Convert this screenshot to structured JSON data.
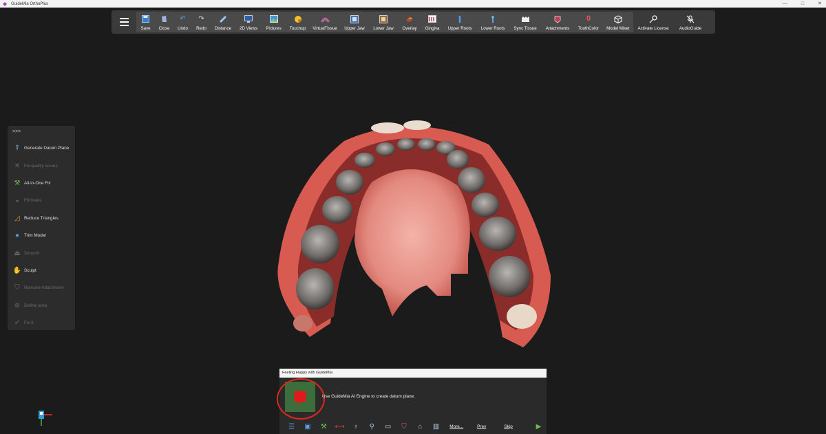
{
  "window": {
    "title": "GuideMia OrthoPlus",
    "minimize": "—",
    "maximize": "□",
    "close": "✕"
  },
  "toolbar": {
    "groups": [
      [
        {
          "id": "save",
          "label": "Save",
          "icon": "save-icon"
        },
        {
          "id": "close",
          "label": "Close",
          "icon": "close-file-icon"
        },
        {
          "id": "undo",
          "label": "Undo",
          "icon": "undo-icon"
        },
        {
          "id": "redo",
          "label": "Redo",
          "icon": "redo-icon"
        },
        {
          "id": "distance",
          "label": "Distance",
          "icon": "ruler-icon"
        },
        {
          "id": "2d-views",
          "label": "2D Views",
          "icon": "monitor-icon"
        },
        {
          "id": "pictures",
          "label": "Pictures",
          "icon": "picture-icon"
        },
        {
          "id": "touchup",
          "label": "Touchup",
          "icon": "touchup-icon"
        },
        {
          "id": "virtualtissue",
          "label": "VirtualTissue",
          "icon": "tissue-icon"
        },
        {
          "id": "upper-jaw",
          "label": "Upper Jaw",
          "icon": "upper-jaw-icon"
        },
        {
          "id": "lower-jaw",
          "label": "Lower Jaw",
          "icon": "lower-jaw-icon"
        },
        {
          "id": "overlay",
          "label": "Overlay",
          "icon": "overlay-icon"
        },
        {
          "id": "gingiva",
          "label": "Gingiva",
          "icon": "gingiva-icon"
        },
        {
          "id": "upper-roots",
          "label": "Upper Roots",
          "icon": "upper-roots-icon"
        },
        {
          "id": "lower-roots",
          "label": "Lower Roots",
          "icon": "lower-roots-icon"
        },
        {
          "id": "sync-tissue",
          "label": "Sync Tissue",
          "icon": "sync-tissue-icon"
        },
        {
          "id": "attachments",
          "label": "Attachments",
          "icon": "attachment-icon"
        },
        {
          "id": "toothcolor",
          "label": "ToothColor",
          "icon": "tooth-color-icon"
        },
        {
          "id": "model-mixer",
          "label": "Model Mixer",
          "icon": "cube-icon"
        }
      ],
      [
        {
          "id": "activate-license",
          "label": "Activate License",
          "icon": "key-icon"
        },
        {
          "id": "audioguide",
          "label": "AudioGuide",
          "icon": "mic-off-icon"
        }
      ]
    ]
  },
  "side_panel": {
    "expand_label": ">>>",
    "items": [
      {
        "id": "generate-datum-plane",
        "label": "Generate Datum Plane",
        "icon": "datum-plane-icon",
        "enabled": true
      },
      {
        "id": "fix-quality-issues",
        "label": "Fix quality issues",
        "icon": "tools-cross-icon",
        "enabled": false
      },
      {
        "id": "all-in-one-fix",
        "label": "All-in-One Fix",
        "icon": "hammer-wrench-icon",
        "enabled": true
      },
      {
        "id": "fill-holes",
        "label": "Fill holes",
        "icon": "fill-holes-icon",
        "enabled": false
      },
      {
        "id": "reduce-triangles",
        "label": "Reduce Triangles",
        "icon": "reduce-triangles-icon",
        "enabled": true
      },
      {
        "id": "trim-model",
        "label": "Trim Model",
        "icon": "trim-icon",
        "enabled": true
      },
      {
        "id": "smooth",
        "label": "Smooth",
        "icon": "iron-icon",
        "enabled": false
      },
      {
        "id": "sculpt",
        "label": "Sculpt",
        "icon": "sculpt-icon",
        "enabled": true
      },
      {
        "id": "remove-attachment",
        "label": "Remove Attachment",
        "icon": "remove-attachment-icon",
        "enabled": false
      },
      {
        "id": "define-area",
        "label": "Define area",
        "icon": "define-area-icon",
        "enabled": false
      },
      {
        "id": "fix-it",
        "label": "Fix it",
        "icon": "check-wave-icon",
        "enabled": false
      }
    ]
  },
  "guide": {
    "header": "Feeling Happy with GuideMia",
    "message": "Use GuideMia AI Engine to create datum plane.",
    "links": {
      "more": "More...",
      "prev": "Prev",
      "skip": "Skip"
    }
  },
  "colors": {
    "toolbar_bg": "#3a3a3a",
    "viewport_bg": "#1b1b1b",
    "highlight_circle": "#e0281f",
    "guide_image_bg": "#3e6d3c"
  }
}
